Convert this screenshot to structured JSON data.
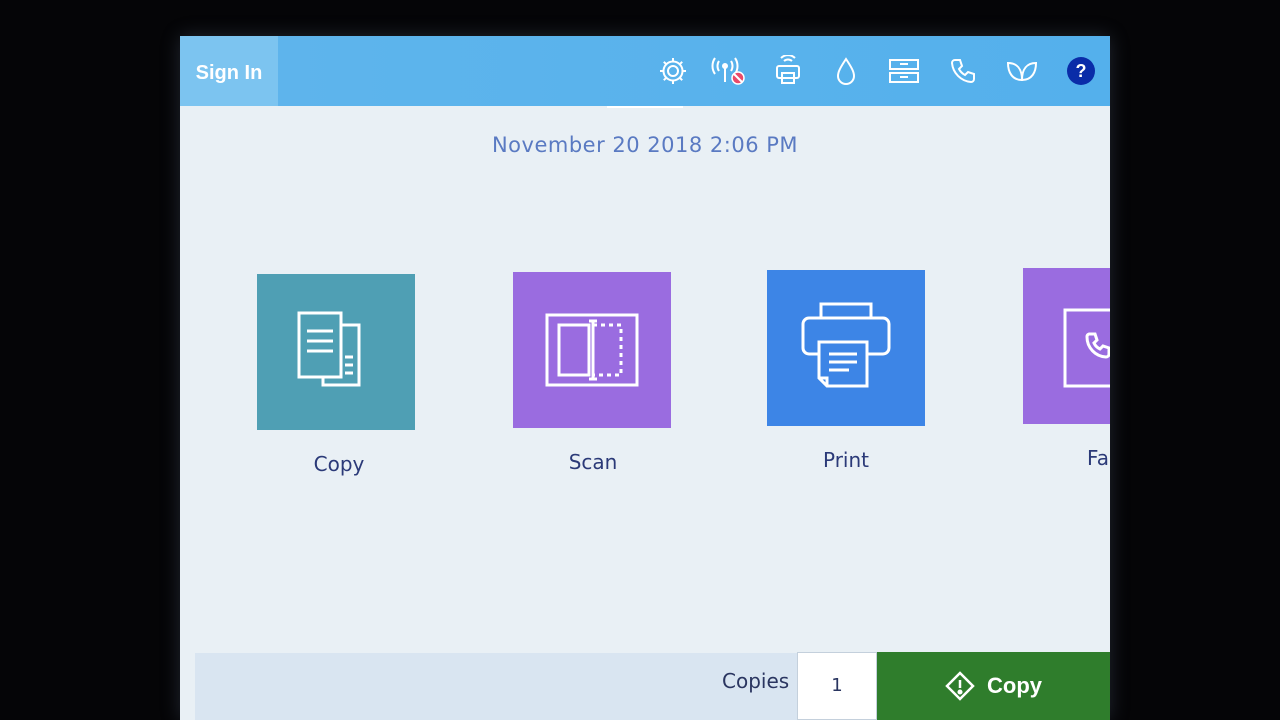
{
  "header": {
    "sign_in_label": "Sign In",
    "icons": [
      "gear-icon",
      "wireless-off-icon",
      "wifi-direct-icon",
      "ink-drop-icon",
      "tray-icon",
      "phone-icon",
      "leaf-icon",
      "help-icon"
    ],
    "help_glyph": "?"
  },
  "datetime": "November 20 2018  2:06 PM",
  "apps": [
    {
      "label": "Copy",
      "color": "#4f9fb4",
      "icon": "copy-icon"
    },
    {
      "label": "Scan",
      "color": "#9a6ce0",
      "icon": "scan-icon"
    },
    {
      "label": "Print",
      "color": "#3d85e6",
      "icon": "printer-icon"
    },
    {
      "label": "Fa",
      "color": "#9a6ce0",
      "icon": "fax-icon"
    }
  ],
  "footer": {
    "copies_label": "Copies",
    "copies_value": "1",
    "start_label": "Copy",
    "start_color": "#2f7d2c"
  },
  "colors": {
    "topbar": "#54b0ec",
    "background": "#e9f0f5",
    "text_accent": "#5a7ac2"
  }
}
